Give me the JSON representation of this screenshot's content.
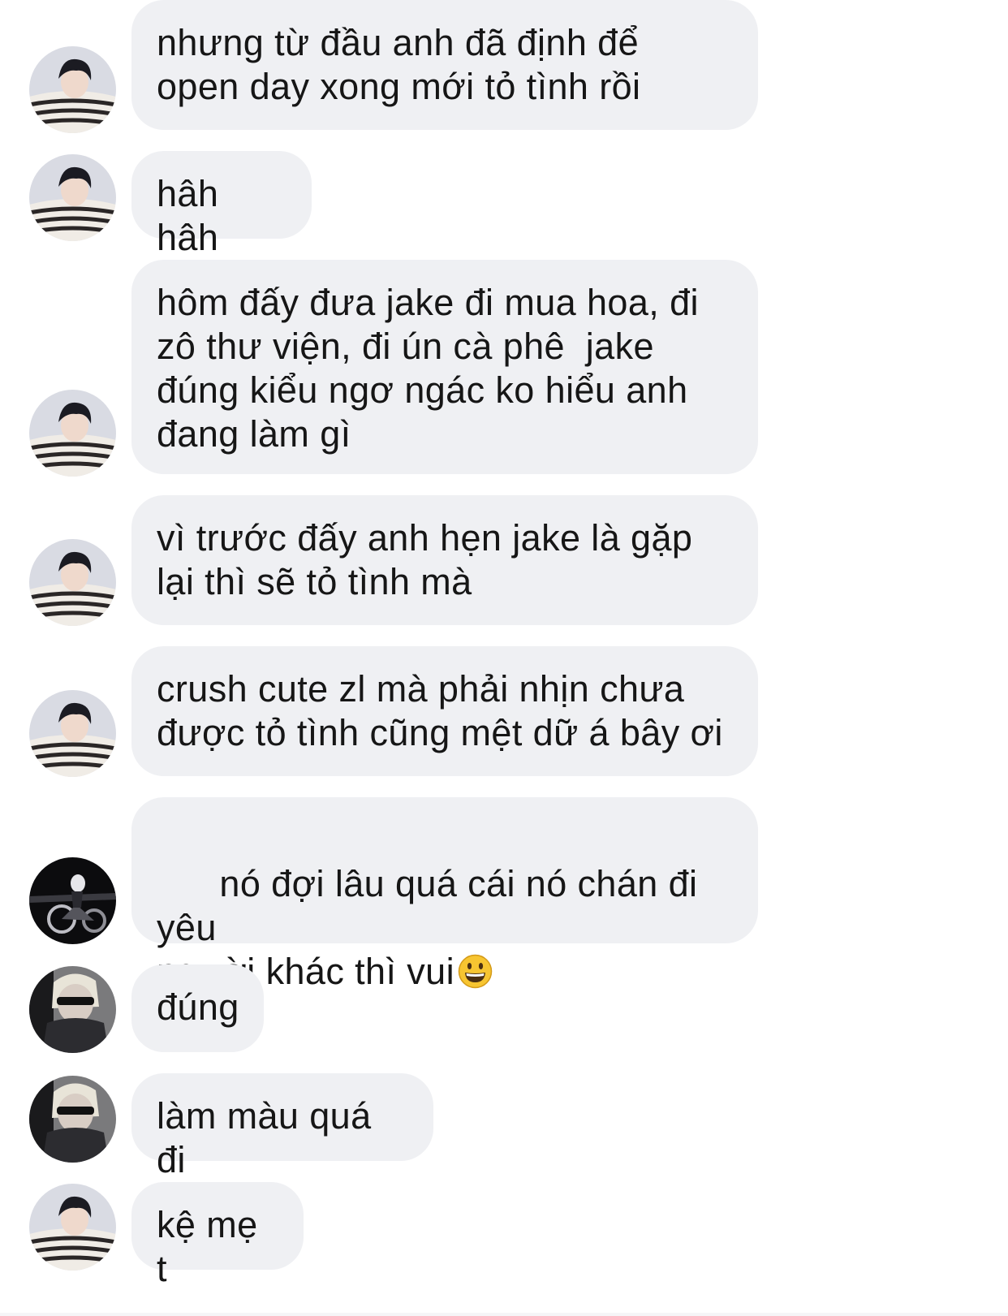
{
  "conversation": {
    "messages": [
      {
        "sender": "striped-sweater-user",
        "text": "nhưng từ đầu anh đã định để\nopen day xong mới tỏ tình rồi"
      },
      {
        "sender": "striped-sweater-user",
        "text": "hâh hâh"
      },
      {
        "sender": "striped-sweater-user",
        "text": "hôm đấy đưa jake đi mua hoa, đi\nzô thư viện, đi ún cà phê  jake\nđúng kiểu ngơ ngác ko hiểu anh\nđang làm gì"
      },
      {
        "sender": "striped-sweater-user",
        "text": "vì trước đấy anh hẹn jake là gặp\nlại thì sẽ tỏ tình mà"
      },
      {
        "sender": "striped-sweater-user",
        "text": "crush cute zl mà phải nhịn chưa\nđược tỏ tình cũng mệt dữ á bây ơi"
      },
      {
        "sender": "motorbike-user",
        "text": "nó đợi lâu quá cái nó chán đi yêu\nngười khác thì vui",
        "emoji": "grinning-face-emoji"
      },
      {
        "sender": "sunglasses-user",
        "text": "đúng"
      },
      {
        "sender": "sunglasses-user",
        "text": "làm màu quá đi"
      },
      {
        "sender": "striped-sweater-user",
        "text": "kệ mẹ t"
      }
    ]
  },
  "colors": {
    "bubble": "#eff0f3",
    "text": "#161616",
    "background": "#ffffff",
    "emoji_face": "#f7c531"
  }
}
